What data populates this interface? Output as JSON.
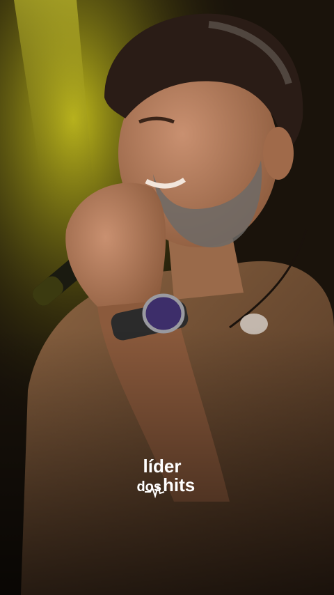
{
  "watermark": {
    "line1": "líder",
    "line2_left": "dos",
    "line2_right": "hits",
    "color": "#ffffff"
  },
  "colors": {
    "background_dark": "#120d08",
    "stage_light_yellow": "#c8c21c",
    "shirt": "#7a5638",
    "skin": "#b07a57",
    "hair": "#2a1c16",
    "watch_face": "#3d2e6a"
  }
}
